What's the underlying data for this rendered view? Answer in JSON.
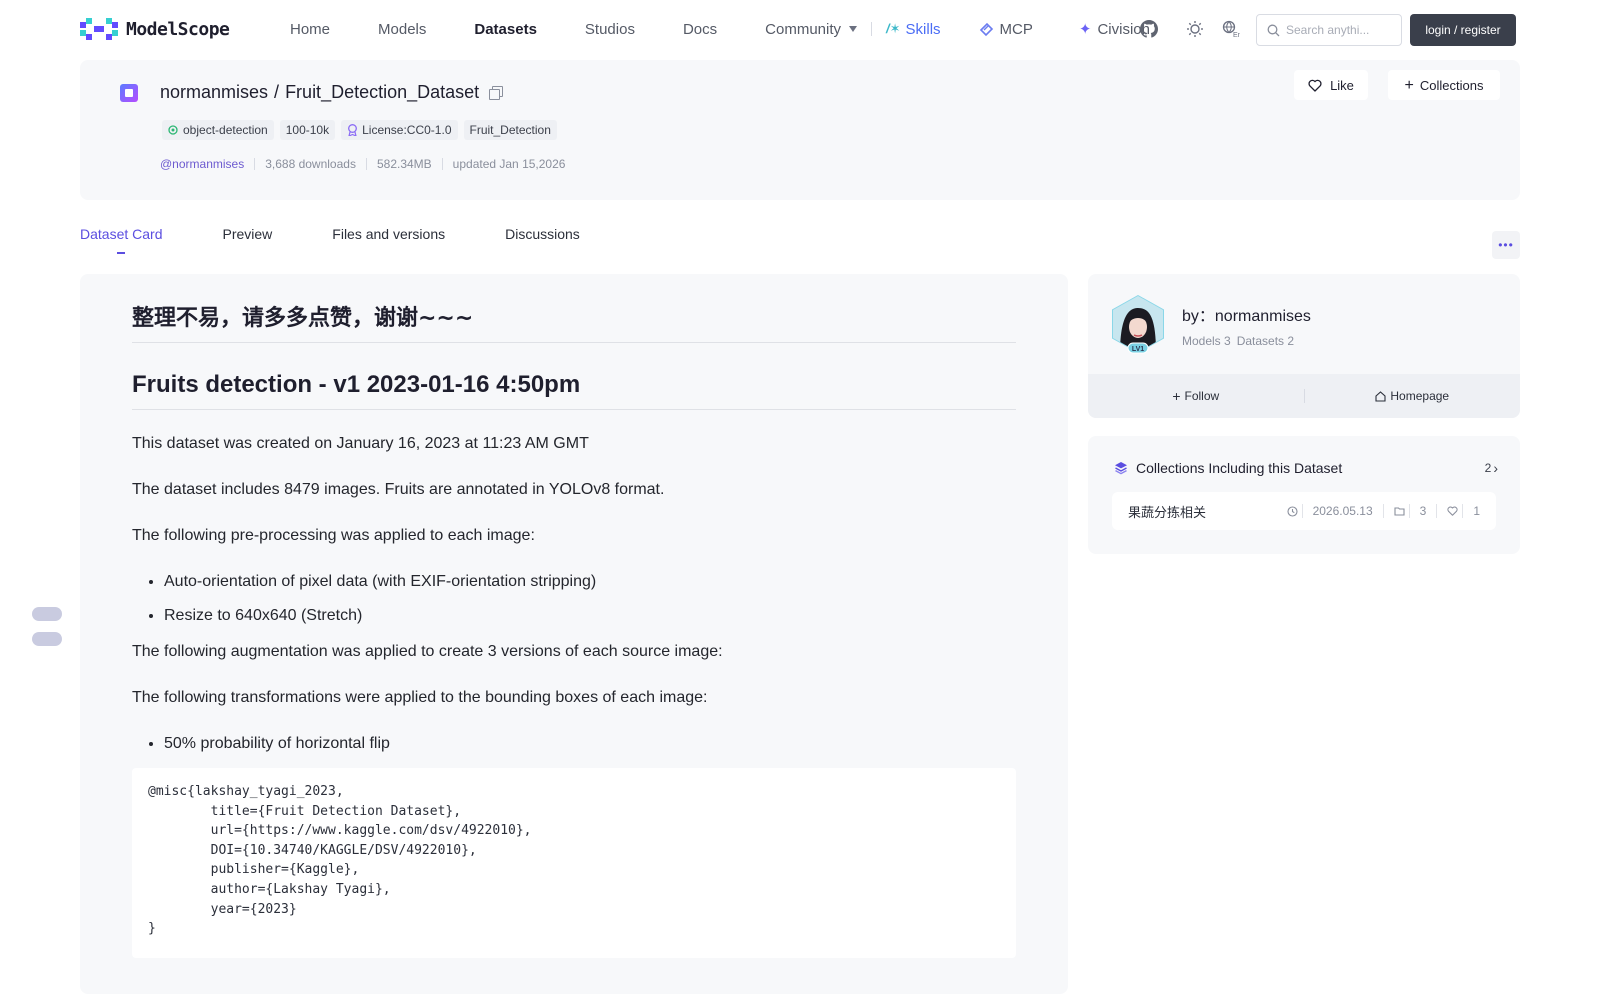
{
  "header": {
    "logo_text": "ModelScope",
    "nav": {
      "home": "Home",
      "models": "Models",
      "datasets": "Datasets",
      "studios": "Studios",
      "docs": "Docs",
      "community": "Community",
      "skills": "Skills",
      "mcp": "MCP",
      "civision": "Civision"
    },
    "search_placeholder": "Search anythi...",
    "login": "login / register",
    "accent": "#5b4ee0"
  },
  "dataset": {
    "owner": "normanmises",
    "slash": "/",
    "name": "Fruit_Detection_Dataset",
    "tags": [
      "object-detection",
      "100-10k",
      "License:CC0-1.0",
      "Fruit_Detection"
    ],
    "author_handle": "@normanmises",
    "downloads": "3,688 downloads",
    "size": "582.34MB",
    "updated": "updated Jan 15,2026",
    "like_label": "Like",
    "collections_label": "Collections"
  },
  "tabs": [
    "Dataset Card",
    "Preview",
    "Files and versions",
    "Discussions"
  ],
  "card": {
    "h1": "整理不易，请多多点赞，谢谢~~~",
    "h2": "Fruits detection - v1 2023-01-16 4:50pm",
    "p1": "This dataset was created on January 16, 2023 at 11:23 AM GMT",
    "p2": "The dataset includes 8479 images. Fruits are annotated in YOLOv8 format.",
    "p3": "The following pre-processing was applied to each image:",
    "list1": [
      "Auto-orientation of pixel data (with EXIF-orientation stripping)",
      "Resize to 640x640 (Stretch)"
    ],
    "p4": "The following augmentation was applied to create 3 versions of each source image:",
    "p5": "The following transformations were applied to the bounding boxes of each image:",
    "list2": [
      "50% probability of horizontal flip"
    ],
    "code": "@misc{lakshay_tyagi_2023,\n        title={Fruit Detection Dataset},\n        url={https://www.kaggle.com/dsv/4922010},\n        DOI={10.34740/KAGGLE/DSV/4922010},\n        publisher={Kaggle},\n        author={Lakshay Tyagi},\n        year={2023}\n}"
  },
  "author": {
    "name": "by：normanmises",
    "models": "Models 3",
    "datasets": "Datasets 2",
    "level": "LV1",
    "follow": "Follow",
    "homepage": "Homepage"
  },
  "collections": {
    "title": "Collections Including this Dataset",
    "count": "2",
    "items": [
      {
        "name": "果蔬分拣相关",
        "date": "2026.05.13",
        "items": "3",
        "likes": "1"
      }
    ]
  }
}
